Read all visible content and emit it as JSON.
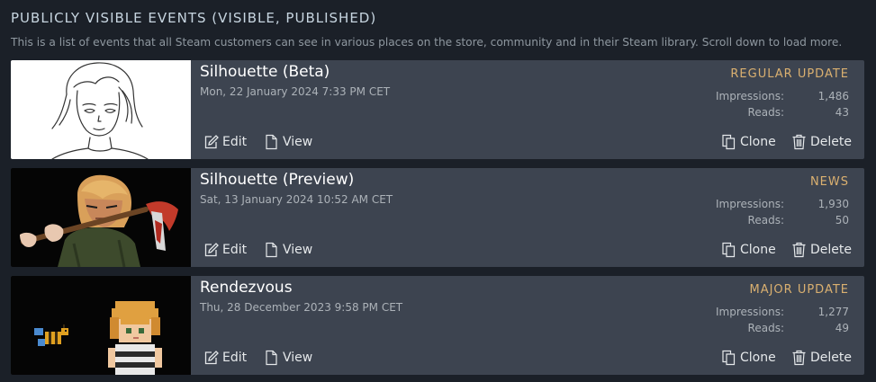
{
  "section": {
    "title": "PUBLICLY VISIBLE EVENTS (VISIBLE, PUBLISHED)",
    "description": "This is a list of events that all Steam customers can see in various places on the store, community and in their Steam library. Scroll down to load more."
  },
  "events": [
    {
      "name": "Silhouette (Beta)",
      "date": "Mon, 22 January 2024 7:33 PM CET",
      "tag": "REGULAR UPDATE",
      "impressions_label": "Impressions:",
      "impressions": "1,486",
      "reads_label": "Reads:",
      "reads": "43",
      "edit_label": "Edit",
      "view_label": "View",
      "clone_label": "Clone",
      "delete_label": "Delete"
    },
    {
      "name": "Silhouette (Preview)",
      "date": "Sat, 13 January 2024 10:52 AM CET",
      "tag": "NEWS",
      "impressions_label": "Impressions:",
      "impressions": "1,930",
      "reads_label": "Reads:",
      "reads": "50",
      "edit_label": "Edit",
      "view_label": "View",
      "clone_label": "Clone",
      "delete_label": "Delete"
    },
    {
      "name": "Rendezvous",
      "date": "Thu, 28 December 2023 9:58 PM CET",
      "tag": "MAJOR UPDATE",
      "impressions_label": "Impressions:",
      "impressions": "1,277",
      "reads_label": "Reads:",
      "reads": "49",
      "edit_label": "Edit",
      "view_label": "View",
      "clone_label": "Clone",
      "delete_label": "Delete"
    }
  ],
  "colors": {
    "page_bg": "#1b2028",
    "card_bg": "#3d4450",
    "tag": "#dab070",
    "title_text": "#ffffff",
    "muted_text": "#acb2b8"
  },
  "icons": {
    "edit": "edit-icon",
    "view": "document-icon",
    "clone": "copy-icon",
    "delete": "trash-icon"
  }
}
